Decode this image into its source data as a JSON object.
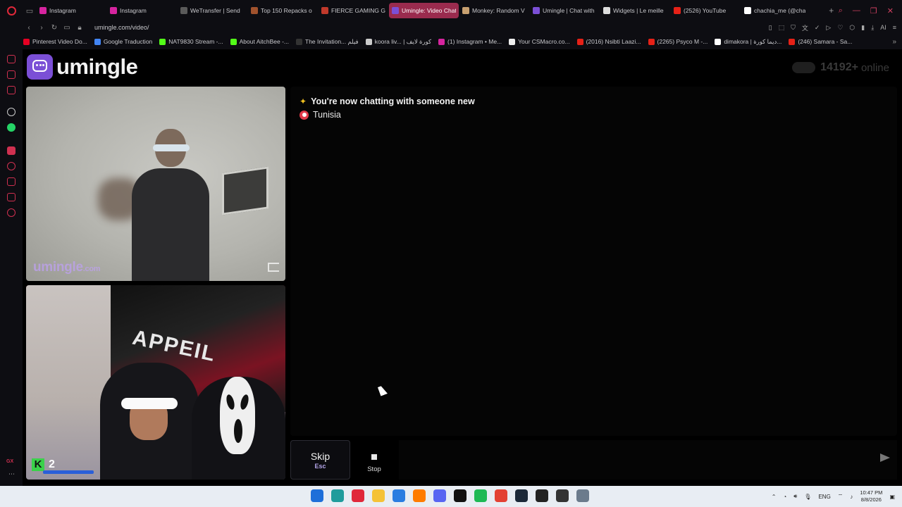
{
  "browser": {
    "tabs": [
      {
        "label": "Instagram",
        "color": "#d6249f",
        "active": false
      },
      {
        "label": "Instagram",
        "color": "#d6249f",
        "active": false
      },
      {
        "label": "WeTransfer | Send",
        "color": "#5a5a5a",
        "active": false
      },
      {
        "label": "Top 150 Repacks o",
        "color": "#a0522d",
        "active": false
      },
      {
        "label": "FIERCE GAMING G",
        "color": "#c0392b",
        "active": false
      },
      {
        "label": "Umingle: Video Chat w",
        "color": "#7b4fd6",
        "active": true
      },
      {
        "label": "Monkey: Random V",
        "color": "#c8a070",
        "active": false
      },
      {
        "label": "Umingle | Chat with",
        "color": "#7b4fd6",
        "active": false
      },
      {
        "label": "Widgets | Le meille",
        "color": "#dddddd",
        "active": false
      },
      {
        "label": "(2526) YouTube",
        "color": "#e62117",
        "active": false
      },
      {
        "label": "chachia_me (@cha",
        "color": "#ffffff",
        "active": false
      }
    ],
    "new_tab_label": "+",
    "url": "umingle.com/video/",
    "bookmarks": [
      {
        "label": "Pinterest Video Do...",
        "color": "#e60023"
      },
      {
        "label": "Google Traduction",
        "color": "#4285f4"
      },
      {
        "label": "NAT9830 Stream -...",
        "color": "#53fc18"
      },
      {
        "label": "About AitchBee -...",
        "color": "#53fc18"
      },
      {
        "label": "The Invitation... فيلم",
        "color": "#333333"
      },
      {
        "label": "koora liv... | كورة لايف",
        "color": "#cccccc"
      },
      {
        "label": "(1) Instagram • Me...",
        "color": "#d6249f"
      },
      {
        "label": "Your CSMacro.co...",
        "color": "#eeeeee"
      },
      {
        "label": "(2016) Nsibti Laazi...",
        "color": "#e62117"
      },
      {
        "label": "(2265) Psyco M -...",
        "color": "#e62117"
      },
      {
        "label": "dimakora | ديما كورة...",
        "color": "#ffffff"
      },
      {
        "label": "(246) Samara - Sa...",
        "color": "#e62117"
      }
    ],
    "bookmarks_more": "»",
    "toolbar_ai": "AI"
  },
  "site": {
    "logo_text": "umingle",
    "online_count": "14192+",
    "online_label": "online",
    "watermark_main": "umingle",
    "watermark_tld": ".com",
    "self_overlay_letter": "K",
    "self_overlay_number": "2",
    "mural_text": "APPEIL"
  },
  "chat": {
    "status_message": "You're now chatting with someone new",
    "country": "Tunisia",
    "input_placeholder": ""
  },
  "controls": {
    "skip_label": "Skip",
    "skip_key": "Esc",
    "stop_label": "Stop"
  },
  "taskbar": {
    "language": "ENG",
    "time": "10:47 PM",
    "date": "8/8/2026",
    "apps": [
      {
        "name": "windows-start",
        "color": "#1e6fd9"
      },
      {
        "name": "edge",
        "color": "#1f9c9c"
      },
      {
        "name": "opera",
        "color": "#e0283a"
      },
      {
        "name": "file-explorer",
        "color": "#f5c236"
      },
      {
        "name": "security",
        "color": "#2a7de1"
      },
      {
        "name": "illustrator",
        "color": "#ff7c00"
      },
      {
        "name": "discord",
        "color": "#5865f2"
      },
      {
        "name": "capcut",
        "color": "#111111"
      },
      {
        "name": "spotify",
        "color": "#1db954"
      },
      {
        "name": "chrome",
        "color": "#e34133"
      },
      {
        "name": "steam",
        "color": "#1b2838"
      },
      {
        "name": "media-player",
        "color": "#222222"
      },
      {
        "name": "obs",
        "color": "#333333"
      },
      {
        "name": "settings",
        "color": "#6b7b8c"
      }
    ]
  }
}
